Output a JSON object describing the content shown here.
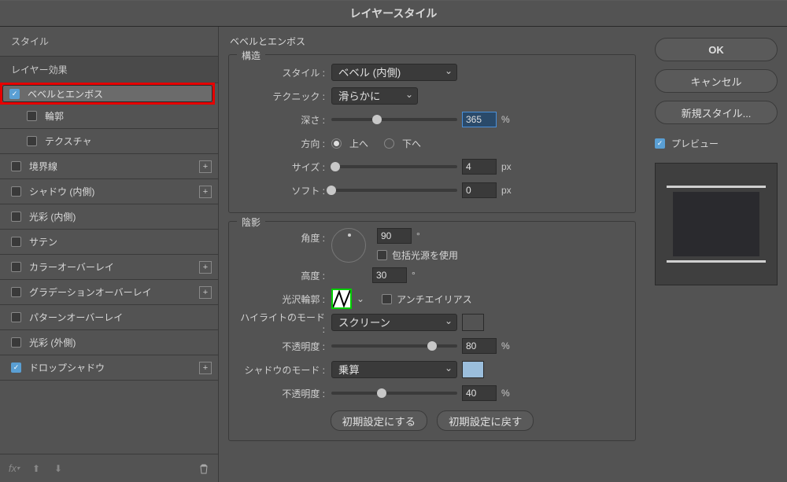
{
  "title": "レイヤースタイル",
  "sidebar": {
    "styles_label": "スタイル",
    "effects_label": "レイヤー効果",
    "items": [
      {
        "label": "ベベルとエンボス",
        "checked": true,
        "selected": true,
        "plus": false,
        "highlight": true
      },
      {
        "label": "輪郭",
        "checked": false,
        "sub": true
      },
      {
        "label": "テクスチャ",
        "checked": false,
        "sub": true
      },
      {
        "label": "境界線",
        "checked": false,
        "plus": true
      },
      {
        "label": "シャドウ (内側)",
        "checked": false,
        "plus": true
      },
      {
        "label": "光彩 (内側)",
        "checked": false
      },
      {
        "label": "サテン",
        "checked": false
      },
      {
        "label": "カラーオーバーレイ",
        "checked": false,
        "plus": true
      },
      {
        "label": "グラデーションオーバーレイ",
        "checked": false,
        "plus": true
      },
      {
        "label": "パターンオーバーレイ",
        "checked": false
      },
      {
        "label": "光彩 (外側)",
        "checked": false
      },
      {
        "label": "ドロップシャドウ",
        "checked": true,
        "plus": true
      }
    ]
  },
  "panel": {
    "title": "ベベルとエンボス",
    "structure_title": "構造",
    "style_label": "スタイル :",
    "style_value": "ベベル (内側)",
    "technique_label": "テクニック :",
    "technique_value": "滑らかに",
    "depth_label": "深さ :",
    "depth_value": "365",
    "depth_unit": "%",
    "direction_label": "方向 :",
    "direction_up": "上へ",
    "direction_down": "下へ",
    "size_label": "サイズ :",
    "size_value": "4",
    "size_unit": "px",
    "soften_label": "ソフト :",
    "soften_value": "0",
    "soften_unit": "px",
    "shading_title": "陰影",
    "angle_label": "角度 :",
    "angle_value": "90",
    "angle_unit": "°",
    "global_label": "包括光源を使用",
    "altitude_label": "高度 :",
    "altitude_value": "30",
    "altitude_unit": "°",
    "gloss_label": "光沢輪郭 :",
    "antialias_label": "アンチエイリアス",
    "highlight_mode_label": "ハイライトのモード :",
    "highlight_mode_value": "スクリーン",
    "highlight_opacity_label": "不透明度 :",
    "highlight_opacity_value": "80",
    "highlight_opacity_unit": "%",
    "shadow_mode_label": "シャドウのモード :",
    "shadow_mode_value": "乗算",
    "shadow_opacity_label": "不透明度 :",
    "shadow_opacity_value": "40",
    "shadow_opacity_unit": "%",
    "make_default": "初期設定にする",
    "reset_default": "初期設定に戻す",
    "highlight_color": "#ffffff",
    "shadow_color": "#9bbedc"
  },
  "right": {
    "ok": "OK",
    "cancel": "キャンセル",
    "new_style": "新規スタイル...",
    "preview": "プレビュー"
  }
}
